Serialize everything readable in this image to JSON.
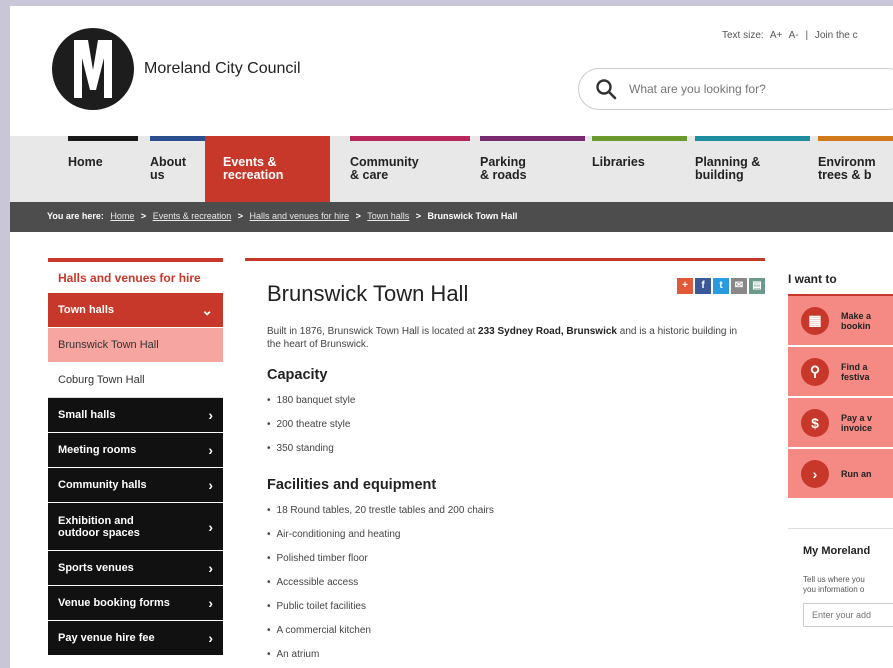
{
  "header": {
    "logo_text": "Moreland City Council",
    "text_size_label": "Text size:",
    "text_size_increase": "A+",
    "text_size_decrease": "A-",
    "util_separator": "|",
    "join_link": "Join the c",
    "search_placeholder": "What are you looking for?"
  },
  "nav": {
    "items": [
      {
        "label": "Home",
        "color": "#1a1a1a"
      },
      {
        "label": "About\nus",
        "color": "#2a4f8f"
      },
      {
        "label": "Events &\nrecreation",
        "color": "#c8382a",
        "active": true
      },
      {
        "label": "Community\n& care",
        "color": "#b8275b"
      },
      {
        "label": "Parking\n& roads",
        "color": "#7a2a6e"
      },
      {
        "label": "Libraries",
        "color": "#6a9a2e"
      },
      {
        "label": "Planning &\nbuilding",
        "color": "#1f8fa0"
      },
      {
        "label": "Environm\ntrees & b",
        "color": "#d07a1a"
      }
    ]
  },
  "breadcrumb": {
    "prefix": "You are here:",
    "links": [
      "Home",
      "Events & recreation",
      "Halls and venues for hire",
      "Town halls"
    ],
    "current": "Brunswick Town Hall",
    "separator": ">"
  },
  "sidebar": {
    "heading": "Halls and venues for hire",
    "items": [
      {
        "label": "Town halls",
        "style": "red",
        "chevron": "⌄"
      },
      {
        "label": "Brunswick Town Hall",
        "style": "pink"
      },
      {
        "label": "Coburg Town Hall",
        "style": "white"
      },
      {
        "label": "Small halls",
        "style": "black",
        "chevron": "›"
      },
      {
        "label": "Meeting rooms",
        "style": "black",
        "chevron": "›"
      },
      {
        "label": "Community halls",
        "style": "black",
        "chevron": "›"
      },
      {
        "label": "Exhibition and outdoor spaces",
        "style": "black",
        "chevron": "›",
        "tall": true
      },
      {
        "label": "Sports venues",
        "style": "black",
        "chevron": "›"
      },
      {
        "label": "Venue booking forms",
        "style": "black",
        "chevron": "›"
      },
      {
        "label": "Pay venue hire fee",
        "style": "black",
        "chevron": "›"
      }
    ]
  },
  "main": {
    "title": "Brunswick Town Hall",
    "share_icons": [
      {
        "name": "plus-share-icon",
        "glyph": "+",
        "color": "#e05a3a"
      },
      {
        "name": "facebook-icon",
        "glyph": "f",
        "color": "#3b5998"
      },
      {
        "name": "twitter-icon",
        "glyph": "t",
        "color": "#2a9ae0"
      },
      {
        "name": "email-icon",
        "glyph": "✉",
        "color": "#888"
      },
      {
        "name": "print-icon",
        "glyph": "▤",
        "color": "#6a9a8a"
      }
    ],
    "intro_prefix": "Built in 1876, Brunswick Town Hall is located at ",
    "intro_address": "233 Sydney Road, Brunswick",
    "intro_suffix": " and is a historic building in the heart of Brunswick.",
    "capacity_heading": "Capacity",
    "capacity": [
      "180 banquet style",
      "200 theatre style",
      "350 standing"
    ],
    "facilities_heading": "Facilities and equipment",
    "facilities": [
      "18 Round tables, 20 trestle tables and 200 chairs",
      "Air-conditioning and heating",
      "Polished timber floor",
      "Accessible access",
      "Public toilet facilities",
      "A commercial kitchen",
      "An atrium"
    ]
  },
  "right": {
    "heading": "I want to",
    "items": [
      {
        "label": "Make a\nbookin",
        "icon": "calendar-icon",
        "glyph": "▦"
      },
      {
        "label": "Find a\nfestiva",
        "icon": "search-icon",
        "glyph": "⚲"
      },
      {
        "label": "Pay a v\ninvoice",
        "icon": "dollar-icon",
        "glyph": "$"
      },
      {
        "label": "Run an",
        "icon": "arrow-right-icon",
        "glyph": "›"
      }
    ],
    "my_heading": "My Moreland",
    "my_text": "Tell us where you\nyou information o",
    "addr_placeholder": "Enter your add"
  }
}
